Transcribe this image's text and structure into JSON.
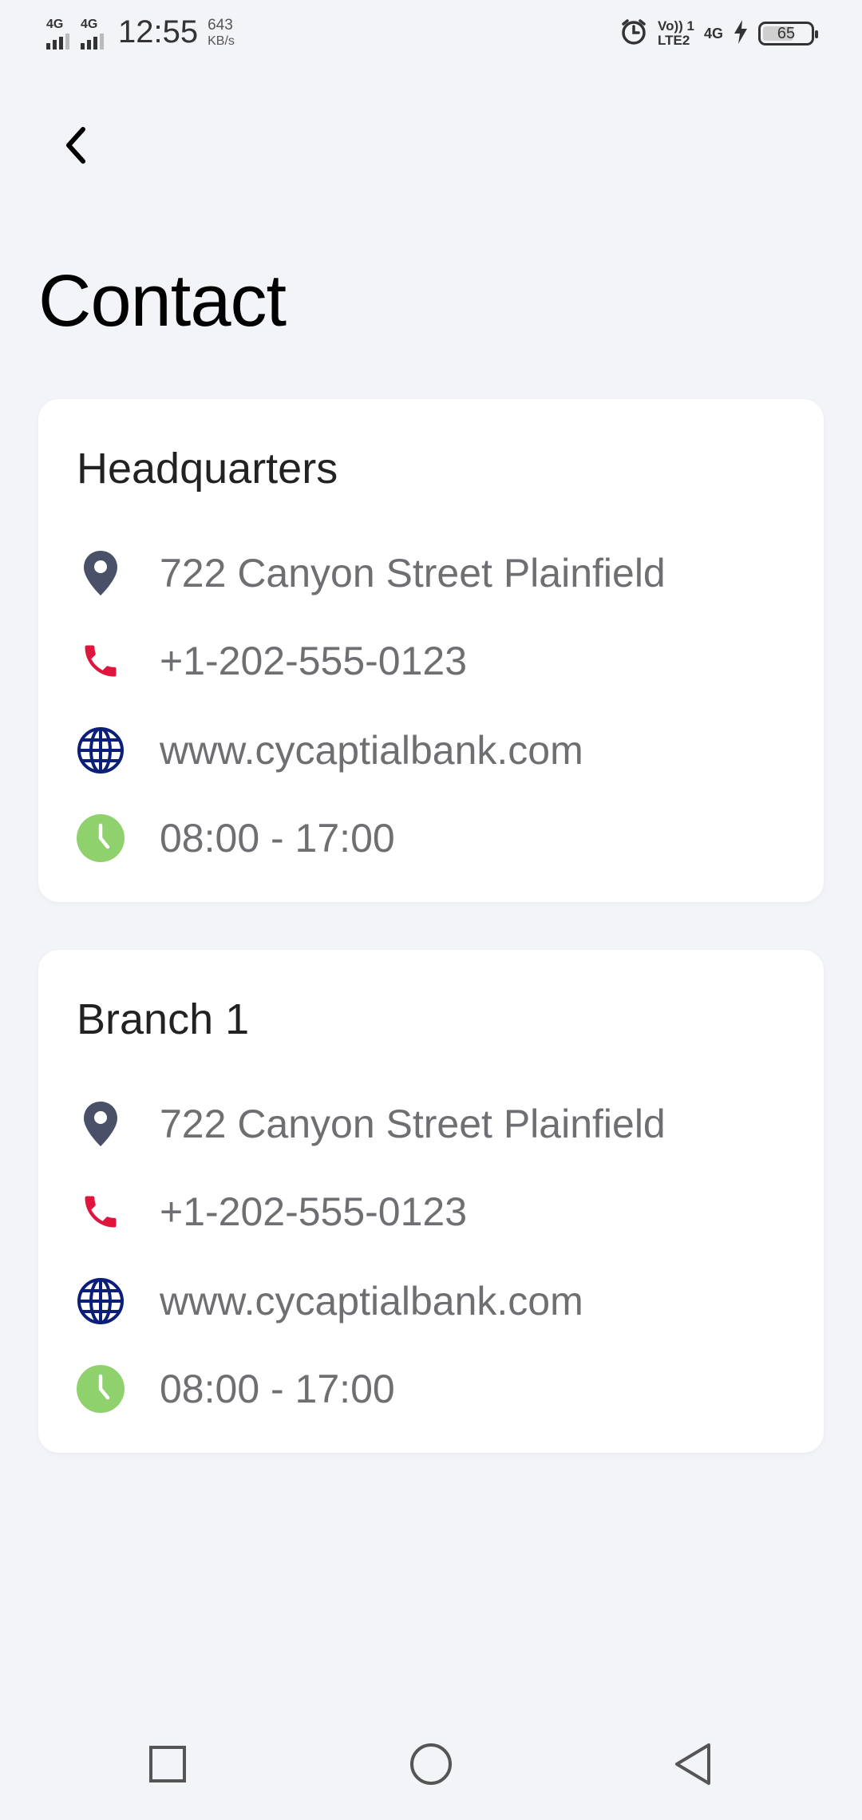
{
  "status_bar": {
    "network_1": "4G",
    "network_2": "4G",
    "time": "12:55",
    "speed_value": "643",
    "speed_unit": "KB/s",
    "volte_top": "Vo)) 1",
    "volte_bottom": "LTE2",
    "network_3": "4G",
    "battery_level": "65",
    "icons": [
      "signal-icon",
      "alarm-icon",
      "charging-icon",
      "battery-icon"
    ]
  },
  "header": {
    "back_icon": "chevron-left-icon",
    "title": "Contact"
  },
  "locations": [
    {
      "name": "Headquarters",
      "address": "722 Canyon Street Plainfield",
      "phone": "+1-202-555-0123",
      "website": "www.cycaptialbank.com",
      "hours": "08:00 - 17:00"
    },
    {
      "name": "Branch 1",
      "address": "722 Canyon Street Plainfield",
      "phone": "+1-202-555-0123",
      "website": "www.cycaptialbank.com",
      "hours": "08:00 - 17:00"
    }
  ],
  "colors": {
    "background": "#f3f4f8",
    "card": "#ffffff",
    "pin": "#4a5068",
    "phone": "#e0143c",
    "globe": "#0b1f7a",
    "clock": "#8fd16d",
    "secondary_text": "#6f6f73"
  },
  "nav_bar": {
    "icons": [
      "recents-icon",
      "home-icon",
      "back-triangle-icon"
    ]
  }
}
